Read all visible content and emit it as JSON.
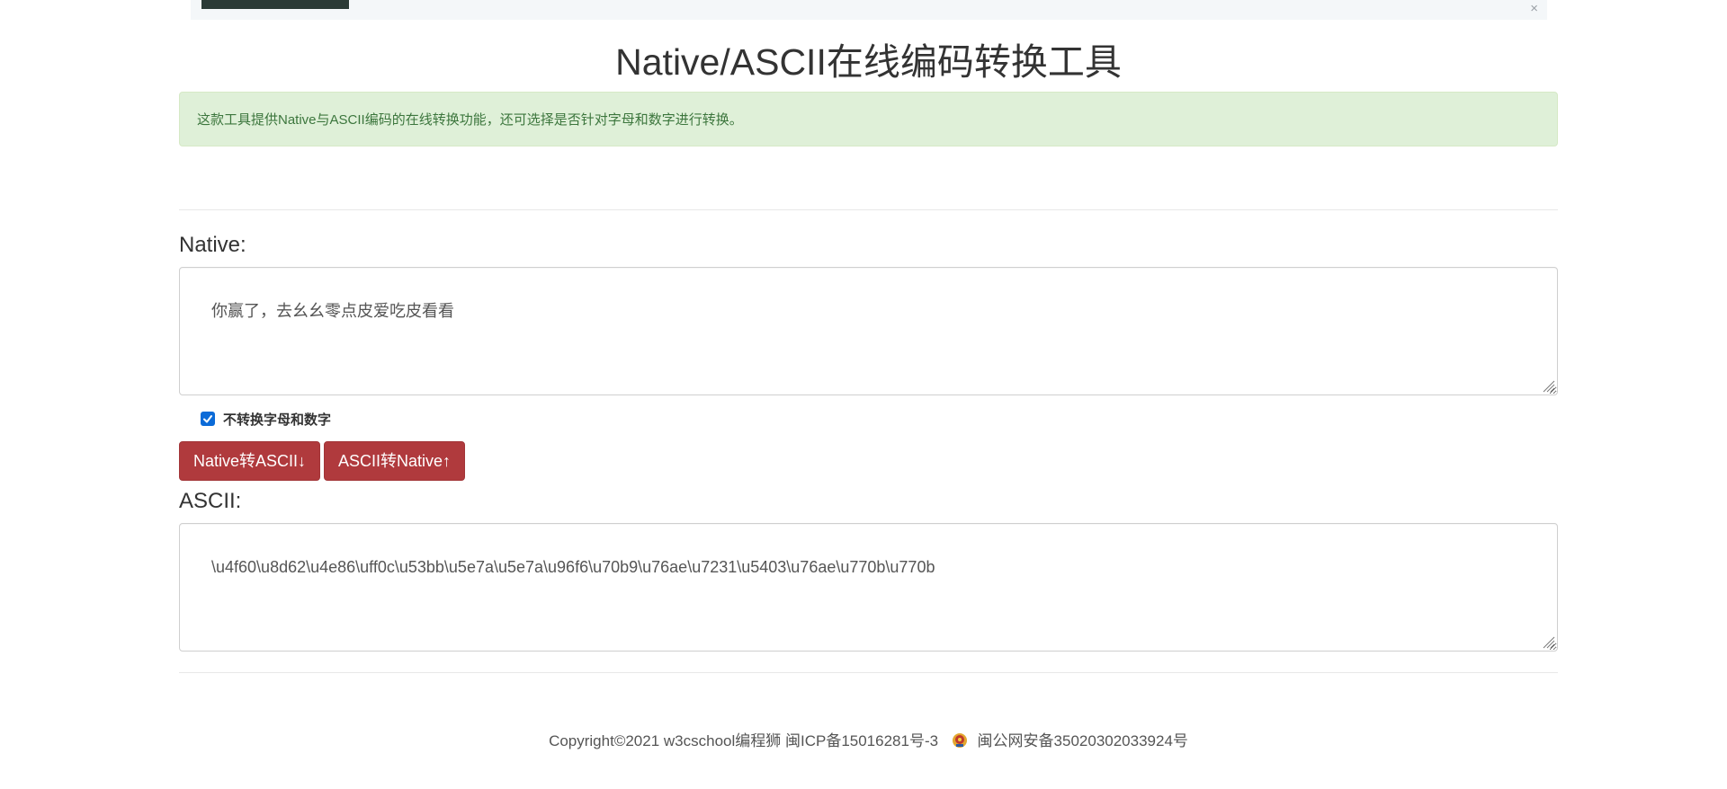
{
  "banner": {
    "close_label": "×"
  },
  "page": {
    "title": "Native/ASCII在线编码转换工具",
    "intro": "这款工具提供Native与ASCII编码的在线转换功能，还可选择是否针对字母和数字进行转换。"
  },
  "native": {
    "label": "Native:",
    "value": "你赢了，去幺幺零点皮爱吃皮看看"
  },
  "options": {
    "skip_alnum_label": "不转换字母和数字",
    "skip_alnum_checked": true
  },
  "buttons": {
    "to_ascii": "Native转ASCII↓",
    "to_native": "ASCII转Native↑"
  },
  "ascii": {
    "label": "ASCII:",
    "value": "\\u4f60\\u8d62\\u4e86\\uff0c\\u53bb\\u5e7a\\u5e7a\\u96f6\\u70b9\\u76ae\\u7231\\u5403\\u76ae\\u770b\\u770b"
  },
  "footer": {
    "copyright": "Copyright©2021 w3cschool编程狮 闽ICP备15016281号-3",
    "police_record": "闽公网安备35020302033924号"
  },
  "colors": {
    "alert_bg": "#dff0d8",
    "alert_text": "#3c763d",
    "button_bg": "#b03a3d",
    "checkbox_accent": "#0b6bd8"
  }
}
